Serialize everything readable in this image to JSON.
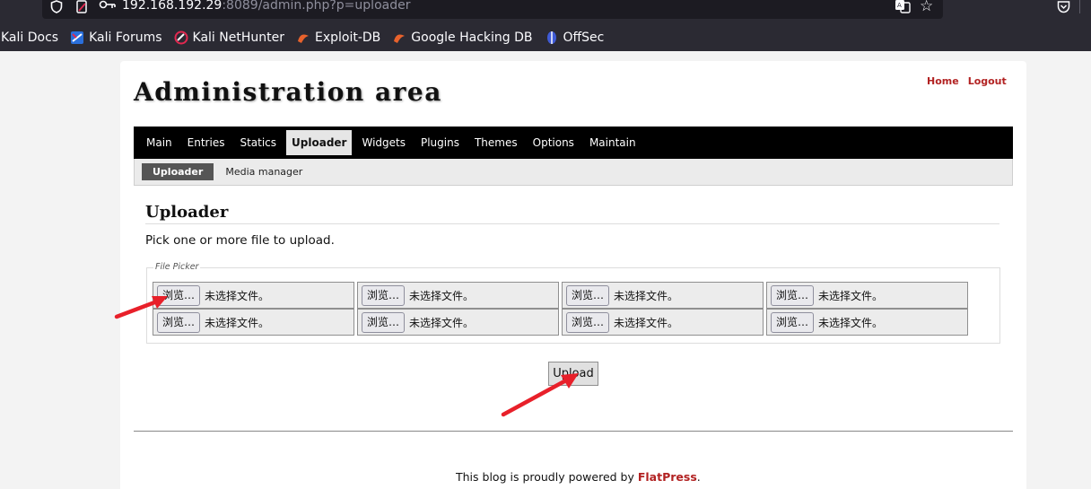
{
  "browser": {
    "url_host": "192.168.192.29",
    "url_rest": ":8089/admin.php?p=uploader",
    "bookmarks": [
      {
        "label": "Kali Docs"
      },
      {
        "label": "Kali Forums"
      },
      {
        "label": "Kali NetHunter"
      },
      {
        "label": "Exploit-DB"
      },
      {
        "label": "Google Hacking DB"
      },
      {
        "label": "OffSec"
      }
    ]
  },
  "header": {
    "title": "Administration area",
    "links": [
      "Home",
      "Logout"
    ]
  },
  "main_nav": [
    "Main",
    "Entries",
    "Statics",
    "Uploader",
    "Widgets",
    "Plugins",
    "Themes",
    "Options",
    "Maintain"
  ],
  "main_nav_active": "Uploader",
  "sub_nav": [
    "Uploader",
    "Media manager"
  ],
  "content": {
    "title": "Uploader",
    "intro": "Pick one or more file to upload.",
    "file_picker_legend": "File Picker",
    "browse_label": "浏览…",
    "no_file_label": "未选择文件。",
    "upload_label": "Upload"
  },
  "footer": {
    "text": "This blog is proudly powered by ",
    "link": "FlatPress",
    "end": "."
  },
  "colors": {
    "link_red": "#b22222",
    "arrow_red": "#e8202a",
    "nav_bg": "#000000"
  }
}
